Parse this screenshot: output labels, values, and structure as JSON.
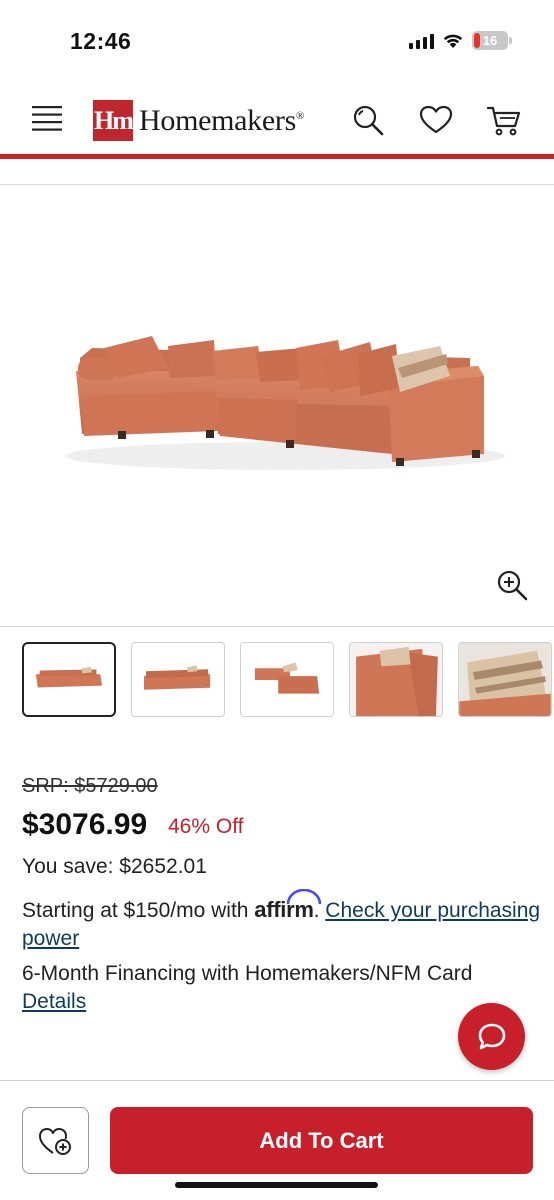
{
  "status_bar": {
    "time": "12:46",
    "battery_level": "16",
    "icons": [
      "cellular-signal-icon",
      "wifi-icon",
      "battery-icon"
    ]
  },
  "header": {
    "logo_mark": "Hm",
    "logo_text": "Homemakers",
    "logo_registered": "®",
    "icons": [
      "menu-icon",
      "search-icon",
      "heart-icon",
      "cart-icon"
    ],
    "accent_color": "#cc2229"
  },
  "product": {
    "srp": "SRP: $5729.00",
    "price": "$3076.99",
    "discount": "46% Off",
    "you_save": "You save: $2652.01",
    "financing_prefix": "Starting at $150/mo with ",
    "affirm_brand": "affirm",
    "financing_suffix": ". ",
    "financing_link": "Check your purchasing power",
    "nfm_text": "6-Month Financing with Homemakers/NFM Card",
    "nfm_link": "Details"
  },
  "gallery": {
    "zoom_icon": "zoom-in-icon",
    "thumbnail_count": 5,
    "selected_index": 0
  },
  "actions": {
    "chat_icon": "chat-bubble-icon",
    "wishlist_icon": "heart-plus-icon",
    "add_to_cart_label": "Add To Cart",
    "button_color": "#c8202a"
  }
}
